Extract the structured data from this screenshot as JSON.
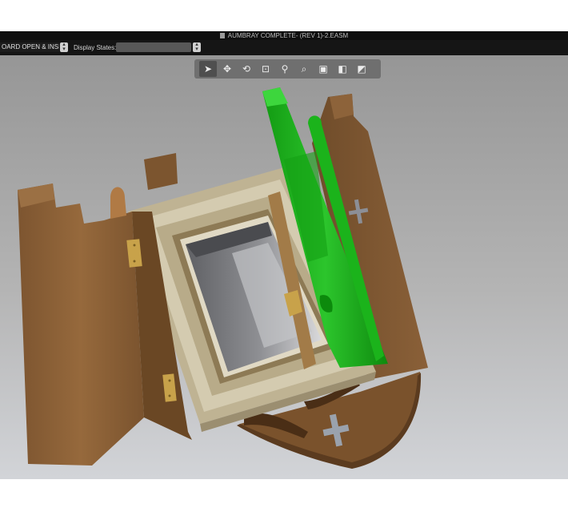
{
  "window": {
    "title": "AUMBRAY COMPLETE- (REV 1)-2.EASM"
  },
  "toolbar": {
    "configuration_value": "OARD OPEN & INSID...",
    "display_states_label": "Display States:",
    "display_states_value": ""
  },
  "view_toolbar": {
    "tools": [
      {
        "name": "select-icon",
        "glyph": "➤"
      },
      {
        "name": "pan-icon",
        "glyph": "✥"
      },
      {
        "name": "rotate-icon",
        "glyph": "⟲"
      },
      {
        "name": "zoom-window-icon",
        "glyph": "⊡"
      },
      {
        "name": "zoom-in-out-icon",
        "glyph": "⚲"
      },
      {
        "name": "zoom-fit-icon",
        "glyph": "⌕"
      },
      {
        "name": "view-orientation-icon",
        "glyph": "▣"
      },
      {
        "name": "display-style-icon",
        "glyph": "◧"
      },
      {
        "name": "section-view-icon",
        "glyph": "◩"
      }
    ]
  },
  "colors": {
    "wood": "#8a5f35",
    "wood_dark": "#6e4a26",
    "frame": "#c9bfa3",
    "highlight_green": "#1faa1f",
    "brass": "#c8a24a"
  }
}
